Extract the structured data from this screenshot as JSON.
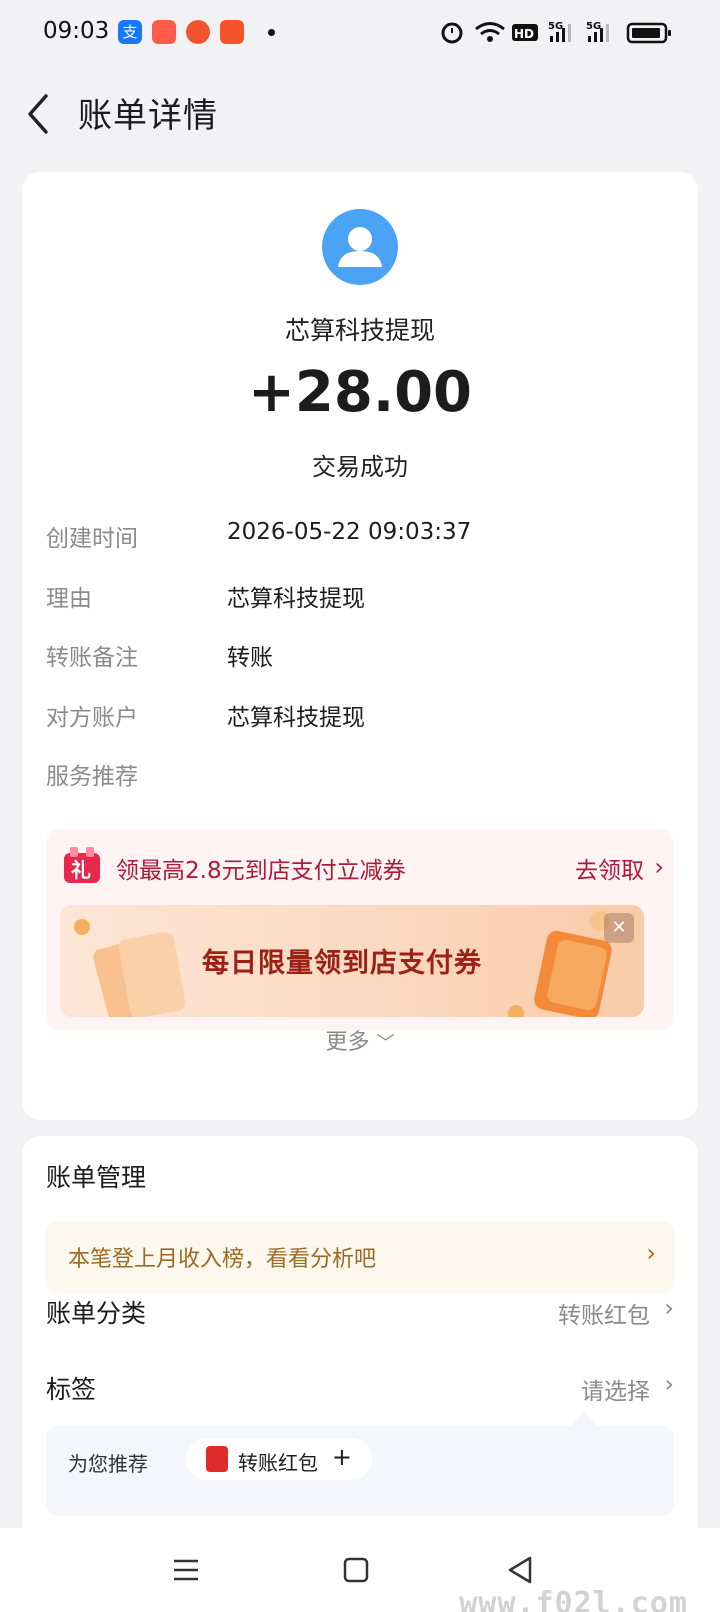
{
  "status_bar": {
    "time": "09:03",
    "apps": [
      {
        "icon": "alipay-icon",
        "glyph": "支",
        "color": "#1677ff"
      },
      {
        "icon": "app-icon-2",
        "glyph": "",
        "color": "#ff5b4d"
      },
      {
        "icon": "app-icon-3",
        "glyph": "",
        "color": "#f2542d"
      },
      {
        "icon": "app-icon-4",
        "glyph": "",
        "color": "#f5532a"
      }
    ],
    "network_hd": "HD",
    "signal_1": "5G",
    "signal_2": "5G"
  },
  "header": {
    "title": "账单详情"
  },
  "transaction": {
    "payee": "芯算科技提现",
    "amount": "+28.00",
    "status": "交易成功",
    "avatar_color": "#4aa3f5"
  },
  "details": [
    {
      "label": "创建时间",
      "value": "2026-05-22 09:03:37"
    },
    {
      "label": "理由",
      "value": "芯算科技提现"
    },
    {
      "label": "转账备注",
      "value": "转账"
    },
    {
      "label": "对方账户",
      "value": "芯算科技提现"
    },
    {
      "label": "服务推荐",
      "value": ""
    }
  ],
  "promo": {
    "gift_glyph": "礼",
    "text": "领最高2.8元到店支付立减券",
    "link": "去领取",
    "banner_text": "每日限量领到店支付券",
    "accent": "#b0183a"
  },
  "more": {
    "label": "更多"
  },
  "management": {
    "title": "账单管理",
    "insight": "本笔登上月收入榜，看看分析吧",
    "category_label": "账单分类",
    "category_value": "转账红包",
    "tag_label": "标签",
    "tag_value": "请选择",
    "recommend_label": "为您推荐",
    "chip_label": "转账红包",
    "chip_plus": "+"
  },
  "watermark": "www.f02l.com"
}
